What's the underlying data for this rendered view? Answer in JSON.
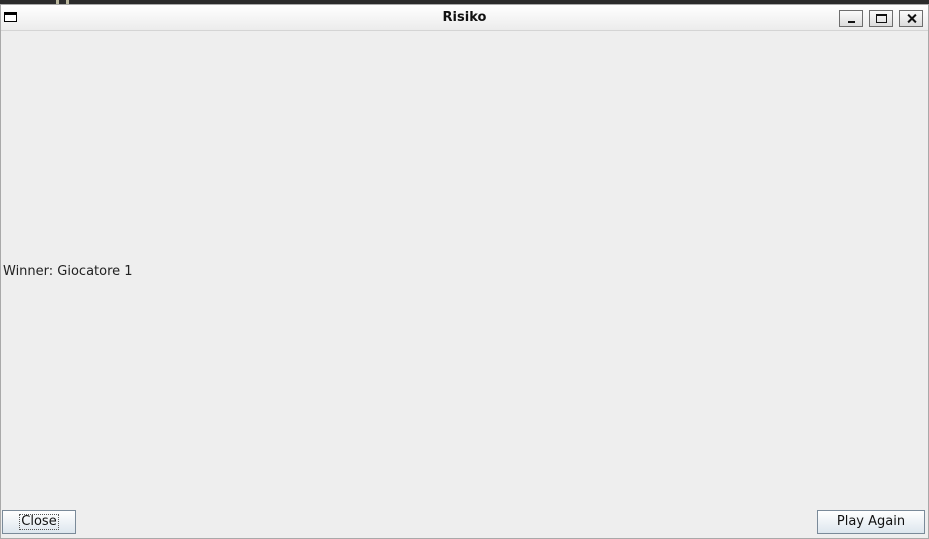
{
  "window": {
    "title": "Risiko"
  },
  "titlebar": {
    "app_icon": "window-icon",
    "controls": [
      "minimize-icon",
      "maximize-icon",
      "close-icon"
    ]
  },
  "content": {
    "winner_text": "Winner: Giocatore 1"
  },
  "buttons": {
    "close_label": "Close",
    "play_again_label": "Play Again"
  }
}
